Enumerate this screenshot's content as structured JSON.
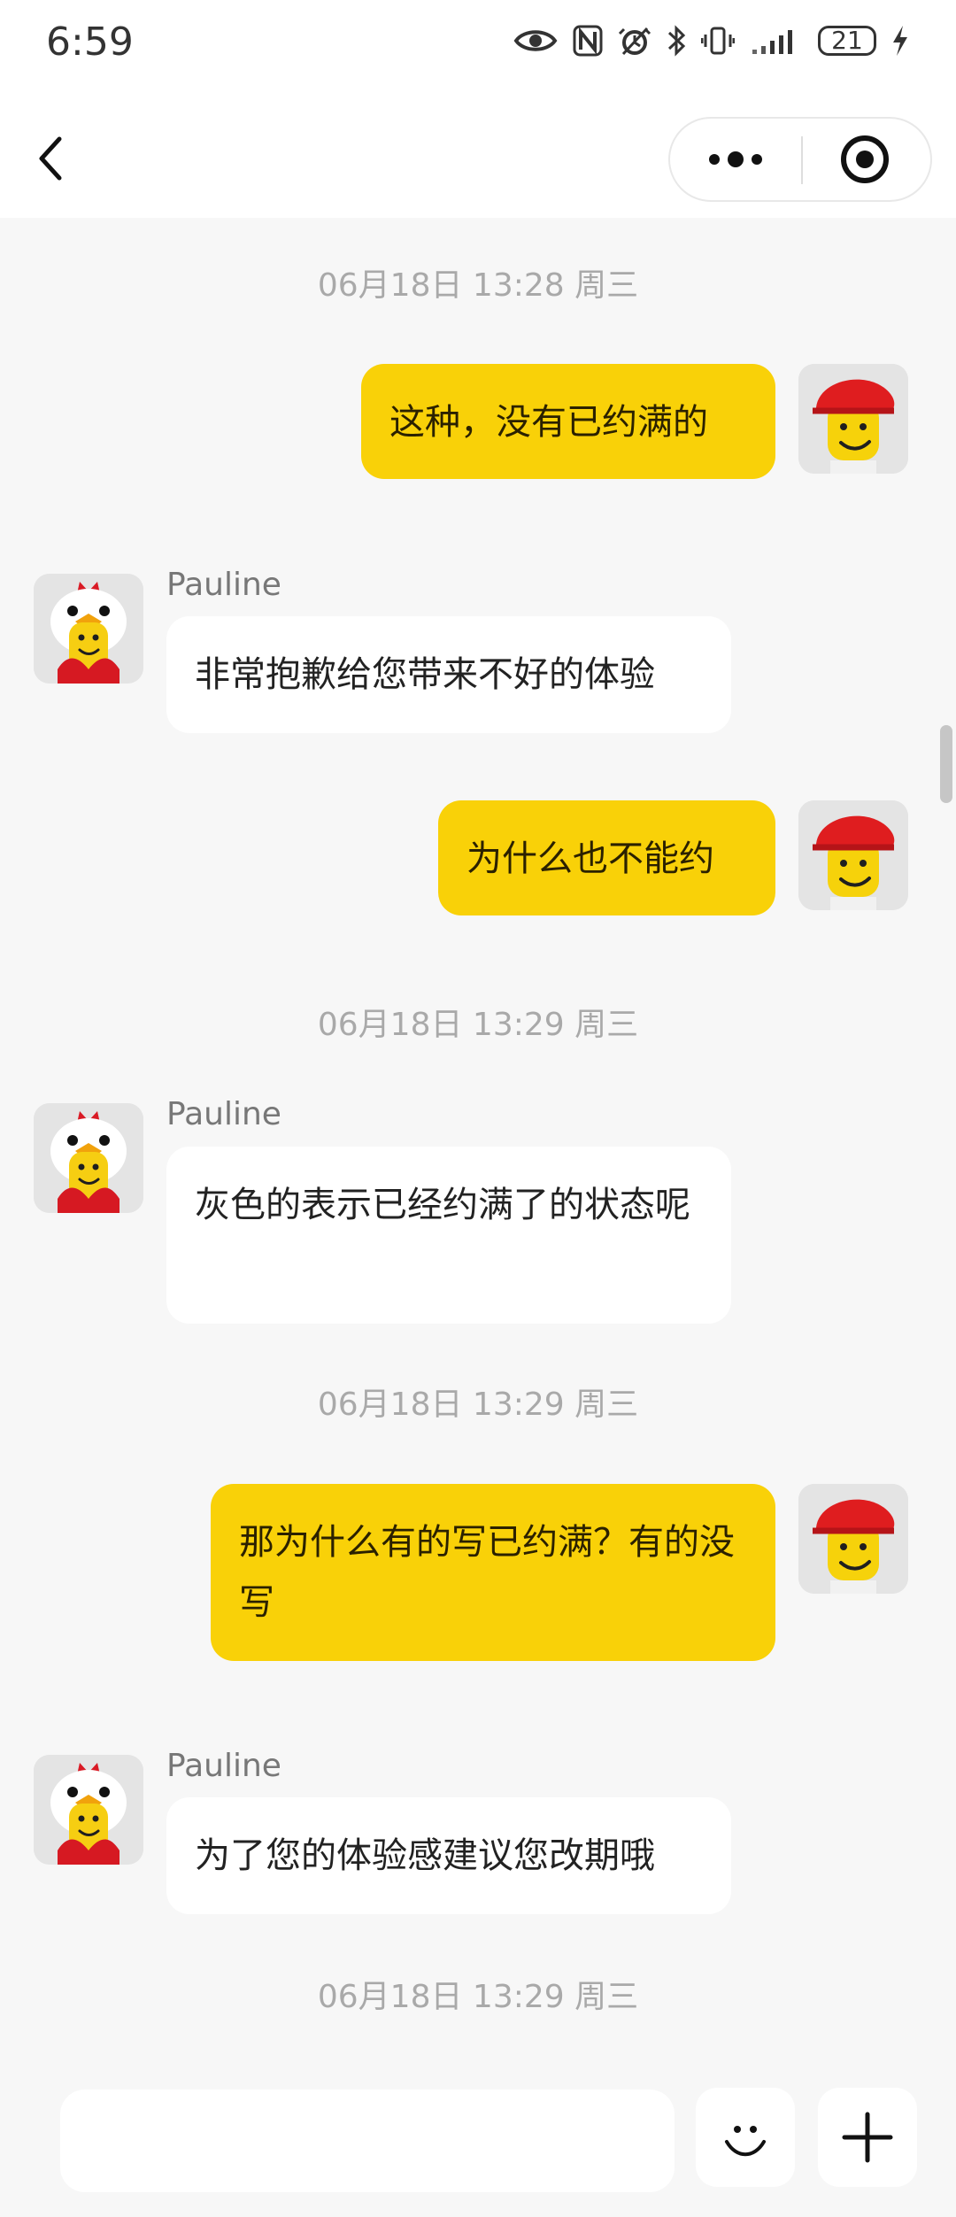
{
  "status_bar": {
    "time": "6:59",
    "battery_level": "21",
    "icons": [
      "eye-icon",
      "nfc-icon",
      "alarm-icon",
      "bluetooth-icon",
      "vibrate-icon",
      "signal-icon",
      "battery-icon",
      "charging-icon"
    ]
  },
  "header": {
    "back_icon": "chevron-left-icon",
    "more_icon": "more-dots-icon",
    "target_icon": "target-icon"
  },
  "chat": {
    "timestamps": [
      "06月18日 13:28 周三",
      "06月18日 13:29 周三",
      "06月18日 13:29 周三",
      "06月18日 13:29 周三"
    ],
    "messages": [
      {
        "side": "self",
        "text": "这种，没有已约满的"
      },
      {
        "side": "agent",
        "sender": "Pauline",
        "text": "非常抱歉给您带来不好的体验"
      },
      {
        "side": "self",
        "text": "为什么也不能约"
      },
      {
        "side": "agent",
        "sender": "Pauline",
        "text": "灰色的表示已经约满了的状态呢"
      },
      {
        "side": "self",
        "text": "那为什么有的写已约满？有的没写"
      },
      {
        "side": "agent",
        "sender": "Pauline",
        "text": "为了您的体验感建议您改期哦"
      }
    ]
  },
  "input_bar": {
    "placeholder": "",
    "emoji_icon": "smile-icon",
    "plus_icon": "plus-icon"
  },
  "colors": {
    "background": "#f7f7f7",
    "self_bubble": "#f9d108",
    "agent_bubble": "#ffffff",
    "timestamp": "#a9a9a9",
    "scrollbar": "#c6c6c6"
  }
}
